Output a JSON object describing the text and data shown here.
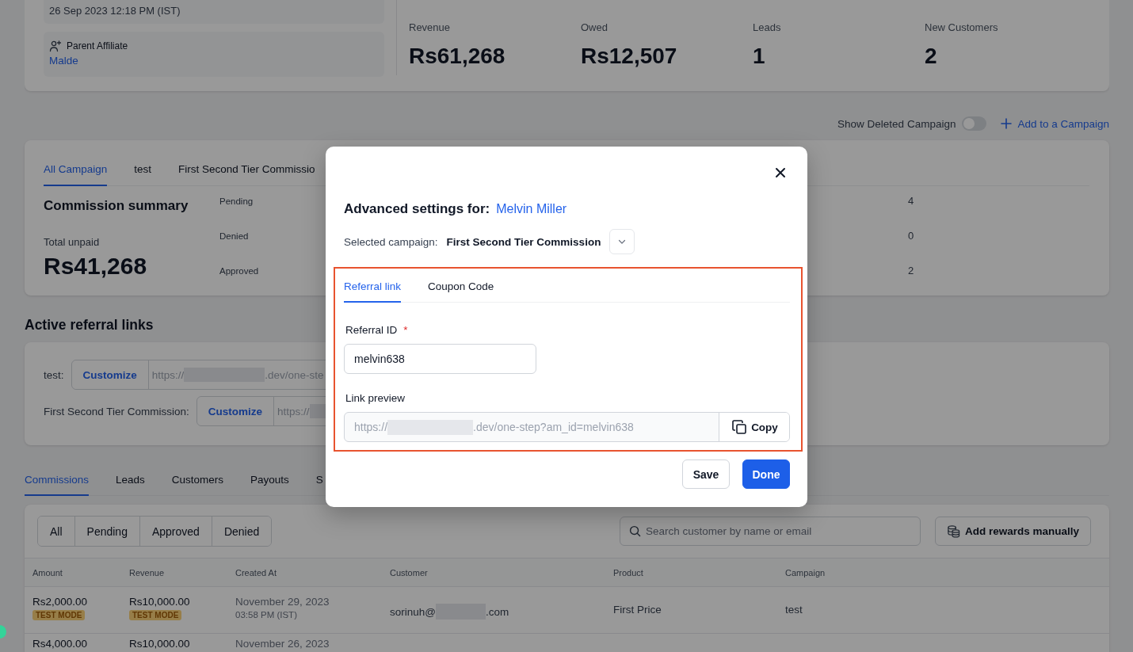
{
  "affiliate_card": {
    "joined_date": "26 Sep 2023 12:18 PM (IST)",
    "parent_affiliate_label": "Parent Affiliate",
    "parent_affiliate": "Malde",
    "stats": [
      {
        "label": "Revenue",
        "value": "Rs61,268"
      },
      {
        "label": "Owed",
        "value": "Rs12,507"
      },
      {
        "label": "Leads",
        "value": "1"
      },
      {
        "label": "New Customers",
        "value": "2"
      }
    ]
  },
  "campaign_controls": {
    "show_deleted_label": "Show Deleted Campaign",
    "show_deleted_on": false,
    "add_campaign": "Add to a Campaign"
  },
  "campaign_card": {
    "tabs": [
      {
        "label": "All Campaign",
        "selected": true
      },
      {
        "label": "test",
        "selected": false
      },
      {
        "label": "First Second Tier Commissio",
        "selected": false
      }
    ],
    "summary_title": "Commission summary",
    "total_unpaid_label": "Total unpaid",
    "total_unpaid": "Rs41,268",
    "statuses": [
      {
        "label": "Pending",
        "count": "4"
      },
      {
        "label": "Denied",
        "count": "0"
      },
      {
        "label": "Approved",
        "count": "2"
      }
    ]
  },
  "referral_links": {
    "title": "Active referral links",
    "links": [
      {
        "campaign": "test:",
        "button": "Customize",
        "url_start": "https://",
        "url_end": ".dev/one-ste"
      },
      {
        "campaign": "First Second Tier Commission:",
        "button": "Customize",
        "url_start": "https://"
      }
    ]
  },
  "section_tabs": [
    {
      "label": "Commissions",
      "selected": true
    },
    {
      "label": "Leads",
      "selected": false
    },
    {
      "label": "Customers",
      "selected": false
    },
    {
      "label": "Payouts",
      "selected": false
    },
    {
      "label": "S",
      "selected": false
    }
  ],
  "commissions": {
    "filters": [
      "All",
      "Pending",
      "Approved",
      "Denied"
    ],
    "search_placeholder": "Search customer by name or email",
    "add_rewards": "Add rewards manually",
    "columns": [
      "Amount",
      "Revenue",
      "Created At",
      "Customer",
      "Product",
      "Campaign"
    ],
    "rows": [
      {
        "amount": "Rs2,000.00",
        "amount_badge": "TEST MODE",
        "revenue": "Rs10,000.00",
        "revenue_badge": "TEST MODE",
        "created_date": "November 29, 2023",
        "created_time": "03:58 PM (IST)",
        "customer_start": "sorinuh@",
        "customer_end": ".com",
        "product": "First Price",
        "campaign": "test"
      },
      {
        "amount": "Rs4,000.00",
        "revenue": "Rs10,000.00",
        "created_date": "November 26, 2023"
      }
    ]
  },
  "modal": {
    "title": "Advanced settings for:",
    "affiliate_name": "Melvin Miller",
    "campaign_label": "Selected campaign:",
    "campaign_value": "First Second Tier Commission",
    "tabs": [
      {
        "label": "Referral link",
        "selected": true
      },
      {
        "label": "Coupon Code",
        "selected": false
      }
    ],
    "referral_id_label": "Referral ID",
    "required_mark": "*",
    "referral_id": "melvin638",
    "link_preview_label": "Link preview",
    "link_start": "https://",
    "link_end": ".dev/one-step?am_id=melvin638",
    "copy": "Copy",
    "buttons": [
      {
        "label": "Save",
        "kind": "secondary"
      },
      {
        "label": "Done",
        "kind": "primary"
      }
    ]
  }
}
